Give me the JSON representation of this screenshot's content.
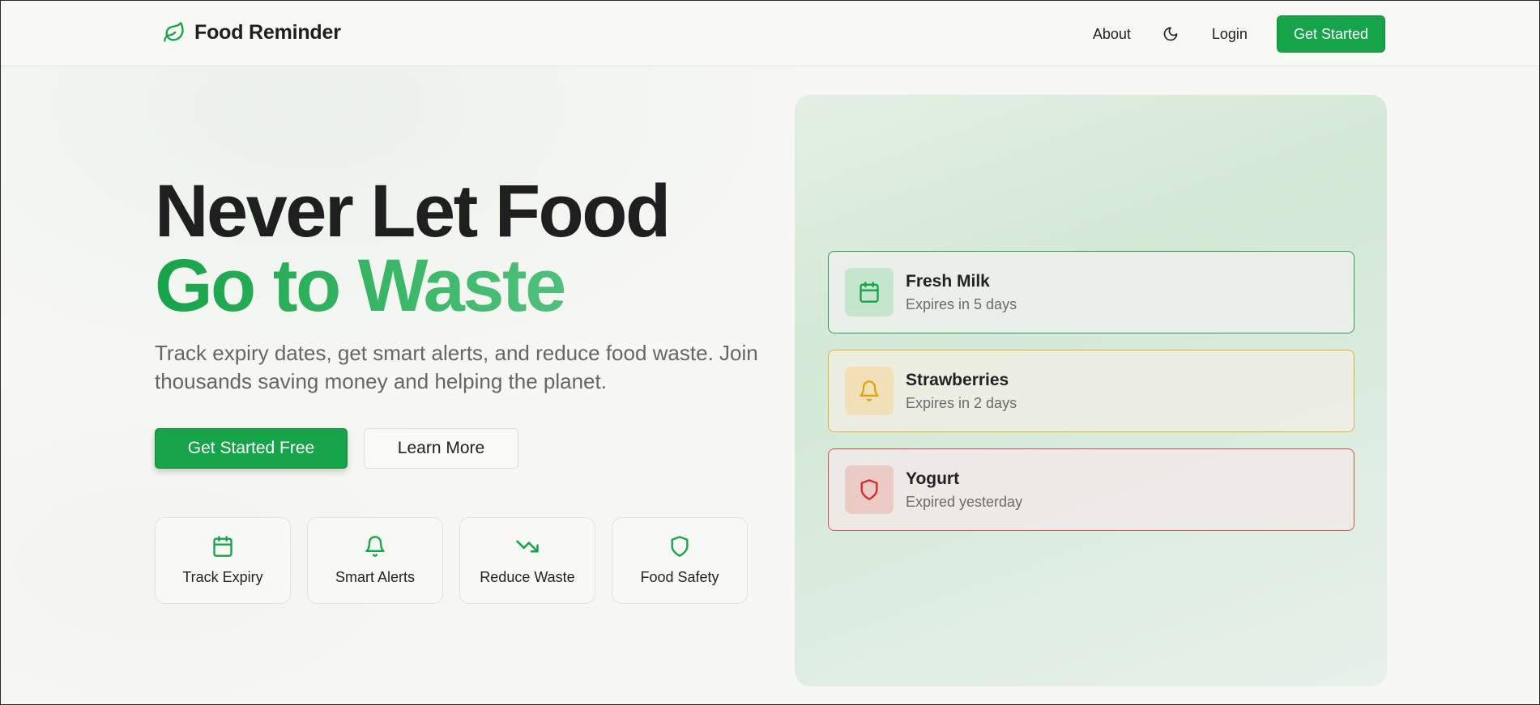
{
  "header": {
    "brand_name": "Food Reminder",
    "brand_icon": "leaf-icon",
    "nav_about": "About",
    "theme_icon": "moon-icon",
    "nav_login": "Login",
    "get_started": "Get Started"
  },
  "hero": {
    "title_line1": "Never Let Food",
    "title_line2": "Go to Waste",
    "subtitle": "Track expiry dates, get smart alerts, and reduce food waste. Join thousands saving money and helping the planet.",
    "cta_primary": "Get Started Free",
    "cta_secondary": "Learn More"
  },
  "features": [
    {
      "label": "Track Expiry",
      "icon": "calendar-icon"
    },
    {
      "label": "Smart Alerts",
      "icon": "bell-icon"
    },
    {
      "label": "Reduce Waste",
      "icon": "trending-down-icon"
    },
    {
      "label": "Food Safety",
      "icon": "shield-icon"
    }
  ],
  "items": [
    {
      "name": "Fresh Milk",
      "status": "Expires in 5 days",
      "icon": "calendar-icon",
      "state": "ok"
    },
    {
      "name": "Strawberries",
      "status": "Expires in 2 days",
      "icon": "bell-icon",
      "state": "warn"
    },
    {
      "name": "Yogurt",
      "status": "Expired yesterday",
      "icon": "shield-icon",
      "state": "expired"
    }
  ],
  "colors": {
    "brand_green": "#16a34a",
    "warning_amber": "#e0a516",
    "danger_red": "#dc2626",
    "text_dark": "#1f1f1f",
    "text_muted": "#666666"
  }
}
